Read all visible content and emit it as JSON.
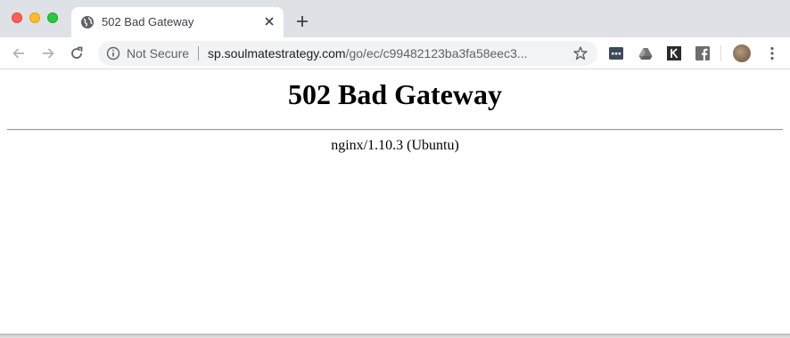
{
  "browser": {
    "tab": {
      "title": "502 Bad Gateway",
      "favicon": "globe-icon"
    },
    "toolbar": {
      "security_label": "Not Secure",
      "url_host": "sp.soulmatestrategy.com",
      "url_path": "/go/ec/c99482123ba3fa58eec3..."
    },
    "extensions": [
      "dots-extension-icon",
      "drive-icon",
      "k-extension-icon",
      "facebook-icon"
    ],
    "colors": {
      "tabstrip": "#dee1e6",
      "omnibox": "#f1f3f4",
      "traffic_close": "#ff5f57",
      "traffic_min": "#febc2e",
      "traffic_max": "#28c840"
    }
  },
  "page": {
    "heading": "502 Bad Gateway",
    "server": "nginx/1.10.3 (Ubuntu)"
  }
}
